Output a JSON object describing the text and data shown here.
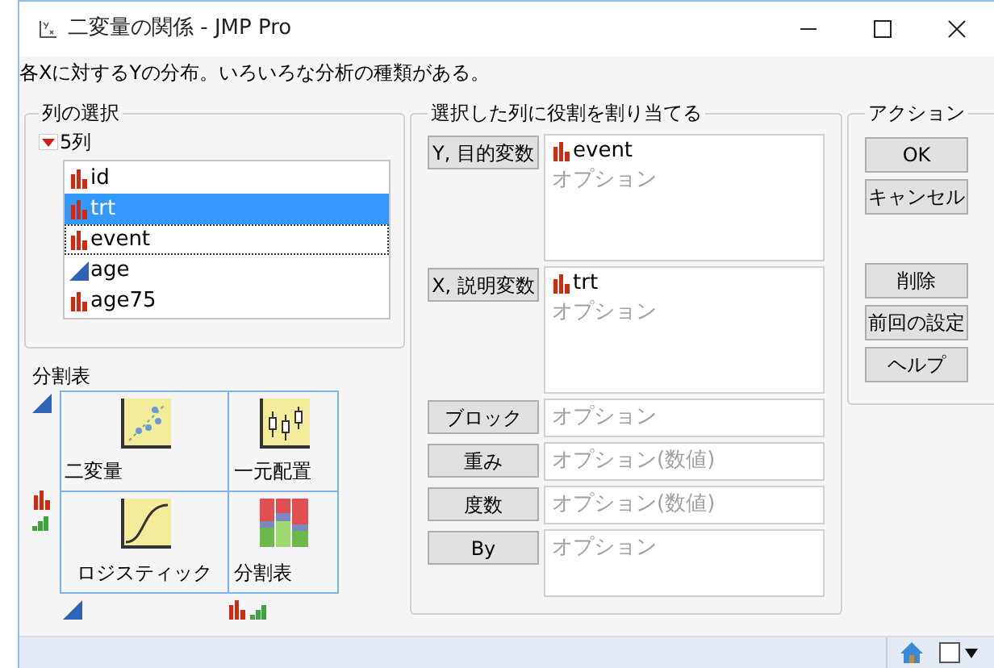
{
  "window": {
    "title": "二変量の関係 - JMP Pro"
  },
  "description": "各Xに対するYの分布。いろいろな分析の種類がある。",
  "column_selection": {
    "title": "列の選択",
    "count_label": "5列",
    "columns": [
      {
        "name": "id",
        "kind": "nominal",
        "selected": false,
        "focused": false
      },
      {
        "name": "trt",
        "kind": "nominal",
        "selected": true,
        "focused": false
      },
      {
        "name": "event",
        "kind": "nominal",
        "selected": false,
        "focused": true
      },
      {
        "name": "age",
        "kind": "continuous",
        "selected": false,
        "focused": false
      },
      {
        "name": "age75",
        "kind": "nominal",
        "selected": false,
        "focused": false
      }
    ]
  },
  "analysis_grid": {
    "title": "分割表",
    "cells": [
      {
        "label": "二変量",
        "kind": "scatter"
      },
      {
        "label": "一元配置",
        "kind": "oneway"
      },
      {
        "label": "ロジスティック",
        "kind": "logistic"
      },
      {
        "label": "分割表",
        "kind": "contingency"
      }
    ]
  },
  "roles": {
    "title": "選択した列に役割を割り当てる",
    "items": [
      {
        "label": "Y, 目的変数",
        "kind": "large",
        "assigned": [
          {
            "name": "event",
            "kind": "nominal"
          }
        ],
        "placeholder": "オプション"
      },
      {
        "label": "X, 説明変数",
        "kind": "large",
        "assigned": [
          {
            "name": "trt",
            "kind": "nominal"
          }
        ],
        "placeholder": "オプション"
      },
      {
        "label": "ブロック",
        "kind": "small",
        "placeholder": "オプション"
      },
      {
        "label": "重み",
        "kind": "small",
        "placeholder": "オプション(数値)"
      },
      {
        "label": "度数",
        "kind": "small",
        "placeholder": "オプション(数値)"
      },
      {
        "label": "By",
        "kind": "medium",
        "placeholder": "オプション"
      }
    ]
  },
  "actions": {
    "title": "アクション",
    "dialog_buttons": [
      "OK",
      "キャンセル"
    ],
    "column_buttons": [
      "削除",
      "前回の設定",
      "ヘルプ"
    ]
  }
}
